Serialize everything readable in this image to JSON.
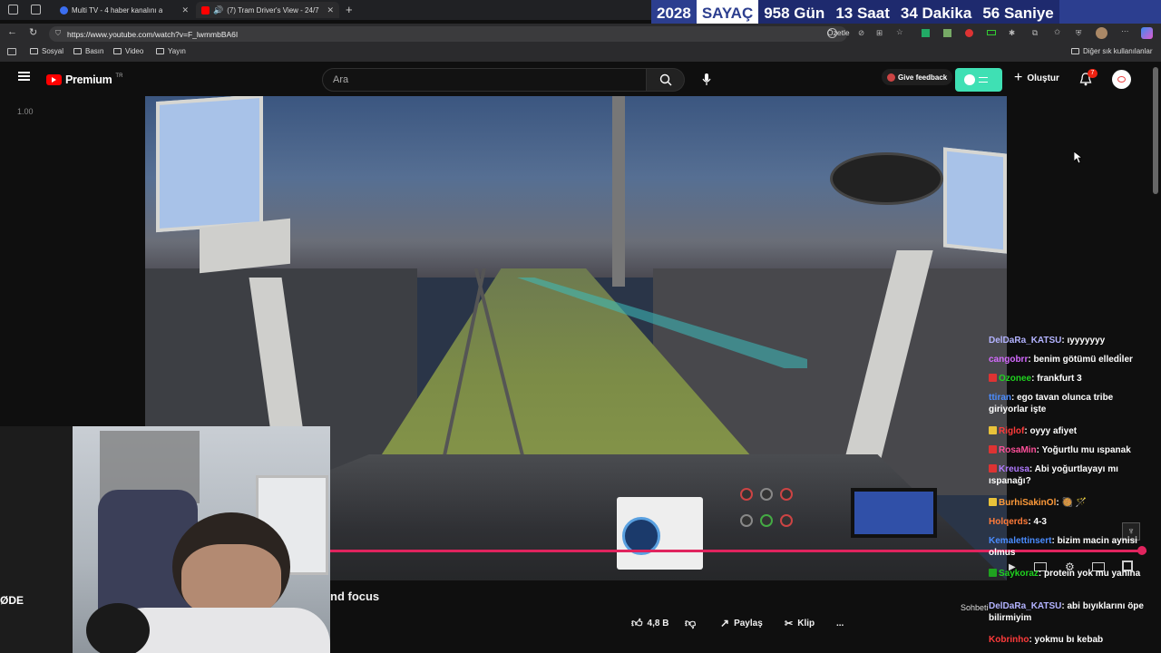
{
  "tabs": [
    {
      "title": "Multi TV - 4 haber kanalını a",
      "favicon_color": "#3b6ef0",
      "active": false
    },
    {
      "title": "(7) Tram Driver's View - 24/7",
      "favicon_color": "#ff0000",
      "active": true
    }
  ],
  "countdown": {
    "year": "2028",
    "label": "SAYAÇ",
    "days": "958 Gün",
    "hours": "13 Saat",
    "minutes": "34 Dakika",
    "seconds": "56 Saniye"
  },
  "address": {
    "url": "https://www.youtube.com/watch?v=F_lwmmbBA6I",
    "summarize_label": "Özetle"
  },
  "bookmarks": {
    "items": [
      "Sosyal",
      "Basın",
      "Video",
      "Yayın"
    ],
    "other": "Diğer sık kullanılanlar"
  },
  "youtube": {
    "logo_text": "Premium",
    "logo_sup": "TR",
    "search_placeholder": "Ara",
    "feedback_label": "Give feedback",
    "create_label": "Oluştur",
    "notification_count": "7",
    "playback_rate": "1.00",
    "progress": 0.99
  },
  "video_below": {
    "title_fragment": "nd focus",
    "likes": "4,8 B",
    "share_label": "Paylaş",
    "clip_label": "Klip",
    "more_label": "...",
    "chat_label": "Sohbeti"
  },
  "chat": [
    {
      "user": "DelDaRa_KATSU",
      "color": "#b3b3ff",
      "badge": null,
      "text": "ıyyyyyyy"
    },
    {
      "user": "cangobrr",
      "color": "#d56aff",
      "badge": null,
      "text": "benim götümü elledi̇ler"
    },
    {
      "user": "Ozonee",
      "color": "#1fd31f",
      "badge": "#d33",
      "text": "frankfurt 3"
    },
    {
      "user": "ttiran",
      "color": "#4a8cff",
      "badge": null,
      "text": "ego tavan olunca tribe giriyorlar işte"
    },
    {
      "user": "Riglof",
      "color": "#ff3b3b",
      "badge": "#e8c23a",
      "text": "oyyy afiyet"
    },
    {
      "user": "RosaMin",
      "color": "#ff4f9a",
      "badge": "#d33",
      "text": "Yoğurtlu mu ıspanak"
    },
    {
      "user": "Kreusa",
      "color": "#b07aff",
      "badge": "#d33",
      "text": "Abi yoğurtlayayı mı ıspanağı?"
    },
    {
      "user": "BurhiSakinOl",
      "color": "#ff9b3a",
      "badge": "#e8c23a",
      "text": "🥘 🪄"
    },
    {
      "user": "Holqerds",
      "color": "#ff7b3a",
      "badge": null,
      "text": "4-3"
    },
    {
      "user": "Kemalettinsert",
      "color": "#4a8cff",
      "badge": null,
      "text": "bizim macin aynisi olmus"
    },
    {
      "user": "Saykoraz",
      "color": "#1fd31f",
      "badge": "#1fa31f",
      "text": "protein yok mu yanına"
    },
    {
      "user": "DelDaRa_KATSU",
      "color": "#b3b3ff",
      "badge": null,
      "text": "abi bıyıklarını öpe bilirmiyim"
    },
    {
      "user": "Kobrinho",
      "color": "#ff3b3b",
      "badge": null,
      "text": "yokmu bı kebab"
    }
  ]
}
